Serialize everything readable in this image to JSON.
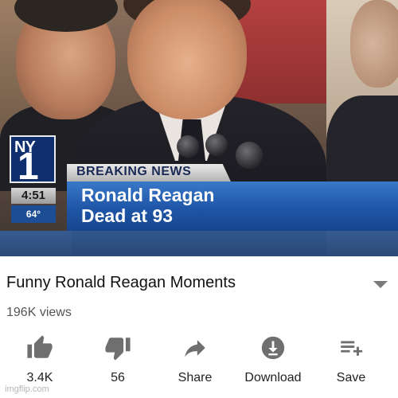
{
  "overlay": {
    "network_top": "NY",
    "network_bottom": "1",
    "clock": "4:51",
    "temperature": "64°",
    "breaking_label": "BREAKING NEWS",
    "headline_line1": "Ronald Reagan",
    "headline_line2": "Dead at 93"
  },
  "video": {
    "title": "Funny Ronald Reagan Moments",
    "views": "196K views"
  },
  "actions": [
    {
      "label": "3.4K",
      "icon": "thumbs-up-icon"
    },
    {
      "label": "56",
      "icon": "thumbs-down-icon"
    },
    {
      "label": "Share",
      "icon": "share-icon"
    },
    {
      "label": "Download",
      "icon": "download-icon"
    },
    {
      "label": "Save",
      "icon": "playlist-add-icon"
    }
  ],
  "watermark": "imgflip.com",
  "colors": {
    "icon": "#6f6f6f",
    "headline_blue": "#1f56a8",
    "network_blue": "#0f2f6e"
  }
}
